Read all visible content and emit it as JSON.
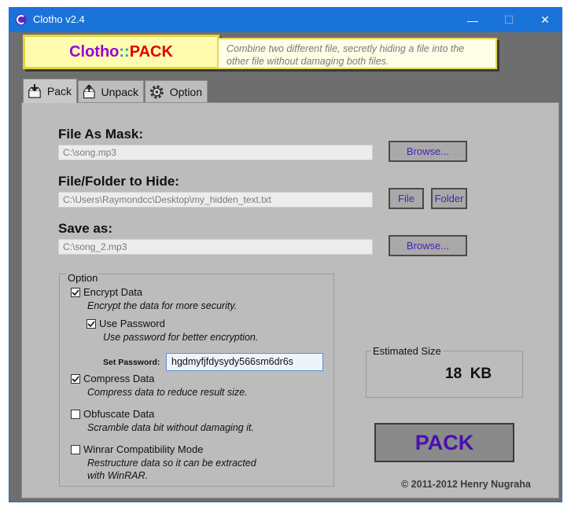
{
  "window": {
    "title": "Clotho v2.4",
    "min_glyph": "—",
    "max_glyph": "☐",
    "close_glyph": "✕"
  },
  "header": {
    "logo_part1": "Clotho",
    "logo_sep": "::",
    "logo_part2": "PACK",
    "description": "Combine two different file, secretly hiding a file into the other file without damaging both files."
  },
  "tabs": [
    {
      "label": "Pack",
      "icon": "box-down-icon",
      "active": true
    },
    {
      "label": "Unpack",
      "icon": "box-up-icon",
      "active": false
    },
    {
      "label": "Option",
      "icon": "gear-icon",
      "active": false
    }
  ],
  "mask": {
    "label": "File As Mask:",
    "value": "C:\\song.mp3",
    "browse_label": "Browse..."
  },
  "hide": {
    "label": "File/Folder to Hide:",
    "value": "C:\\Users\\Raymondcc\\Desktop\\my_hidden_text.txt",
    "file_label": "File",
    "folder_label": "Folder"
  },
  "save": {
    "label": "Save as:",
    "value": "C:\\song_2.mp3",
    "browse_label": "Browse..."
  },
  "options": {
    "legend": "Option",
    "encrypt": {
      "label": "Encrypt Data",
      "hint": "Encrypt the data for more security.",
      "checked": true
    },
    "use_password": {
      "label": "Use Password",
      "hint": "Use password for better encryption.",
      "checked": true
    },
    "set_password_label": "Set Password:",
    "password_value": "hgdmyfjfdysydy566sm6dr6s",
    "compress": {
      "label": "Compress Data",
      "hint": "Compress data to reduce result size.",
      "checked": true
    },
    "obfuscate": {
      "label": "Obfuscate Data",
      "hint": "Scramble data bit without damaging it.",
      "checked": false
    },
    "winrar": {
      "label": "Winrar Compatibility Mode",
      "hint_line1": "Restructure data so it can be extracted",
      "hint_line2": "with WinRAR.",
      "checked": false
    }
  },
  "estimate": {
    "label": "Estimated Size",
    "value": "18  KB"
  },
  "pack_button": "PACK",
  "copyright": "© 2011-2012 Henry Nugraha",
  "colors": {
    "titlebar": "#1a73d9",
    "logo_purple": "#9b00d6",
    "logo_red": "#e00000",
    "button_text": "#4b1fb5"
  }
}
